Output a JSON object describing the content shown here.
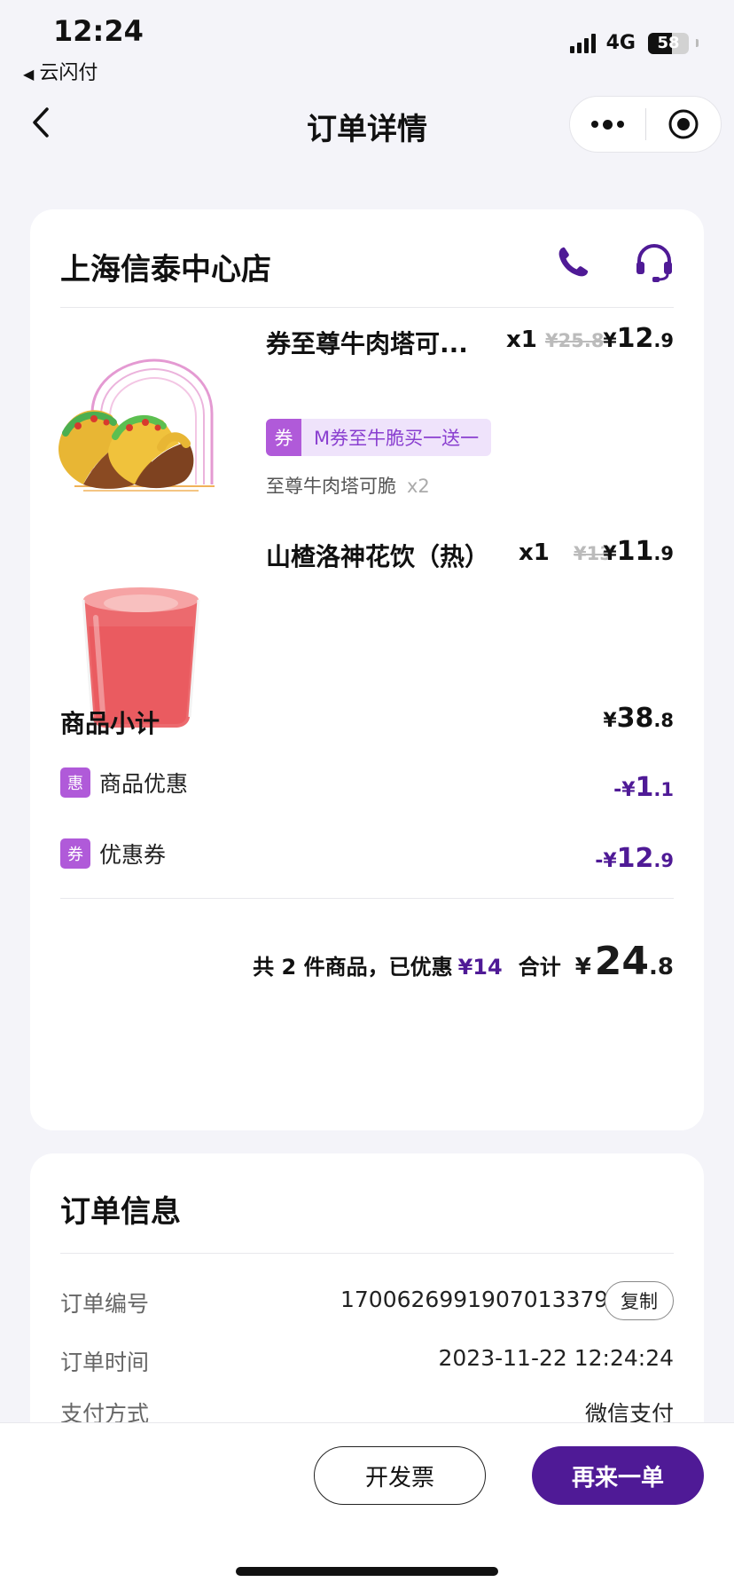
{
  "status_bar": {
    "time": "12:24",
    "back_app": "云闪付",
    "network": "4G",
    "battery": "58",
    "battery_level": 0.58
  },
  "nav": {
    "title": "订单详情"
  },
  "store": {
    "name": "上海信泰中心店"
  },
  "items": [
    {
      "name": "券至尊牛肉塔可...",
      "qty": "x1",
      "old_price": "¥25.8",
      "price_symbol": "¥",
      "price_int": "12",
      "price_dec": ".9",
      "coupon_icon": "券",
      "coupon_text": "M券至牛脆买一送一",
      "sub_name": "至尊牛肉塔可脆",
      "sub_qty": "x2"
    },
    {
      "name": "山楂洛神花饮（热）",
      "qty": "x1",
      "old_price": "¥13",
      "price_symbol": "¥",
      "price_int": "11",
      "price_dec": ".9"
    }
  ],
  "summary": {
    "subtotal_label": "商品小计",
    "subtotal_symbol": "¥",
    "subtotal_int": "38",
    "subtotal_dec": ".8",
    "product_discount_badge": "惠",
    "product_discount_label": "商品优惠",
    "product_discount_symbol": "-¥",
    "product_discount_int": "1",
    "product_discount_dec": ".1",
    "coupon_badge": "券",
    "coupon_label": "优惠券",
    "coupon_symbol": "-¥",
    "coupon_int": "12",
    "coupon_dec": ".9",
    "count_text": "共 2 件商品，已优惠",
    "saved": "¥14",
    "total_label": "合计",
    "total_symbol": "¥",
    "total_int": "24",
    "total_dec": ".8"
  },
  "order_info": {
    "title": "订单信息",
    "order_no_label": "订单编号",
    "order_no": "1700626991907013379",
    "copy_label": "复制",
    "order_time_label": "订单时间",
    "order_time": "2023-11-22 12:24:24",
    "payment_label": "支付方式",
    "payment": "微信支付"
  },
  "actions": {
    "invoice": "开发票",
    "reorder": "再来一单"
  },
  "colors": {
    "accent": "#4f1a96",
    "tag_purple": "#b05ad9",
    "tag_bg": "#efe3fb"
  }
}
